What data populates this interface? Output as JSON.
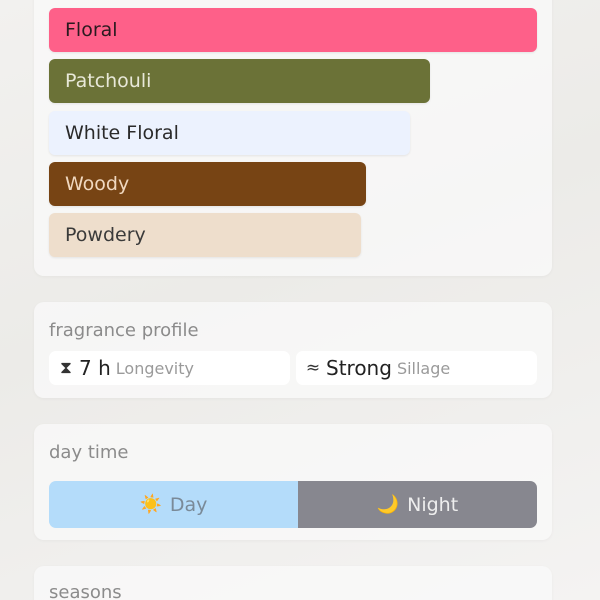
{
  "accords": [
    {
      "label": "Floral",
      "color": "#fe6089",
      "text_color": "#2a1a1f",
      "strength": 1.0
    },
    {
      "label": "Patchouli",
      "color": "#6b7237",
      "text_color": "#e8e8d8",
      "strength": 0.78
    },
    {
      "label": "White Floral",
      "color": "#ecf2fe",
      "text_color": "#2a2a2a",
      "strength": 0.74
    },
    {
      "label": "Woody",
      "color": "#774414",
      "text_color": "#f0d8c0",
      "strength": 0.65
    },
    {
      "label": "Powdery",
      "color": "#eedecc",
      "text_color": "#3a3a3a",
      "strength": 0.64
    }
  ],
  "fragrance_profile": {
    "title": "fragrance profile",
    "longevity": {
      "icon": "hourglass-icon",
      "glyph": "⧗",
      "value": "7 h",
      "label": "Longevity"
    },
    "sillage": {
      "icon": "waves-icon",
      "glyph": "≈",
      "value": "Strong",
      "label": "Sillage"
    }
  },
  "day_time": {
    "title": "day time",
    "day": {
      "icon": "sun-icon",
      "glyph": "☀️",
      "label": "Day",
      "color": "#b4dcfa",
      "share": 0.51
    },
    "night": {
      "icon": "moon-icon",
      "glyph": "🌙",
      "label": "Night",
      "color": "#87878f",
      "share": 0.49
    }
  },
  "seasons": {
    "title": "seasons"
  }
}
